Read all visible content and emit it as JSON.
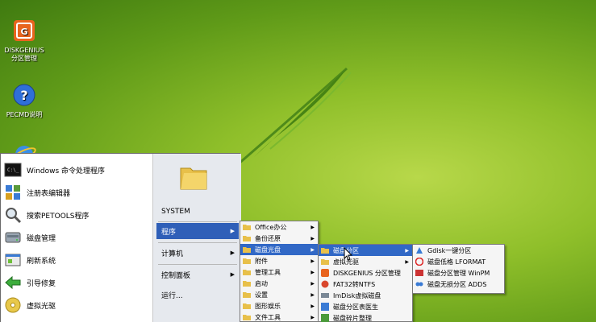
{
  "desktop_icons": [
    {
      "label_line1": "DISKGENIUS",
      "label_line2": "分区管理",
      "icon": "diskgenius-icon"
    },
    {
      "label_line1": "PECMD说明",
      "label_line2": "",
      "icon": "help-icon"
    },
    {
      "label_line1": "",
      "label_line2": "",
      "icon": "ie-icon"
    }
  ],
  "start_menu": {
    "left_items": [
      {
        "label": "Windows 命令处理程序",
        "icon": "cmd-icon"
      },
      {
        "label": "注册表编辑器",
        "icon": "registry-icon"
      },
      {
        "label": "搜索PETOOLS程序",
        "icon": "search-icon"
      },
      {
        "label": "磁盘管理",
        "icon": "disk-manage-icon"
      },
      {
        "label": "刷新系统",
        "icon": "refresh-icon"
      },
      {
        "label": "引导修复",
        "icon": "repair-icon"
      },
      {
        "label": "虚拟光驱",
        "icon": "cdrom-icon"
      }
    ],
    "right_items": {
      "system": "SYSTEM",
      "programs": "程序",
      "computer": "计算机",
      "control_panel": "控制面板",
      "run": "运行..."
    }
  },
  "programs_menu": [
    {
      "label": "Office办公",
      "arrow": true
    },
    {
      "label": "备份还原",
      "arrow": true
    },
    {
      "label": "磁盘光盘",
      "arrow": true,
      "selected": true
    },
    {
      "label": "附件",
      "arrow": true
    },
    {
      "label": "管理工具",
      "arrow": true
    },
    {
      "label": "启动",
      "arrow": true
    },
    {
      "label": "设置",
      "arrow": true
    },
    {
      "label": "图形娱乐",
      "arrow": true
    },
    {
      "label": "文件工具",
      "arrow": true
    }
  ],
  "disk_menu": [
    {
      "label": "磁盘分区",
      "arrow": true,
      "selected": true
    },
    {
      "label": "虚拟光驱",
      "arrow": true
    },
    {
      "label": "DISKGENIUS 分区管理",
      "arrow": false
    },
    {
      "label": "FAT32转NTFS",
      "arrow": false
    },
    {
      "label": "ImDisk虚拟磁盘",
      "arrow": false
    },
    {
      "label": "磁盘分区表医生",
      "arrow": false
    },
    {
      "label": "磁盘碎片整理",
      "arrow": false
    }
  ],
  "partition_menu": [
    {
      "label": "Gdisk一键分区",
      "icon": "gdisk-icon"
    },
    {
      "label": "磁盘低格 LFORMAT",
      "icon": "lformat-icon"
    },
    {
      "label": "磁盘分区管理 WinPM",
      "icon": "winpm-icon"
    },
    {
      "label": "磁盘无损分区 ADDS",
      "icon": "adds-icon"
    }
  ]
}
